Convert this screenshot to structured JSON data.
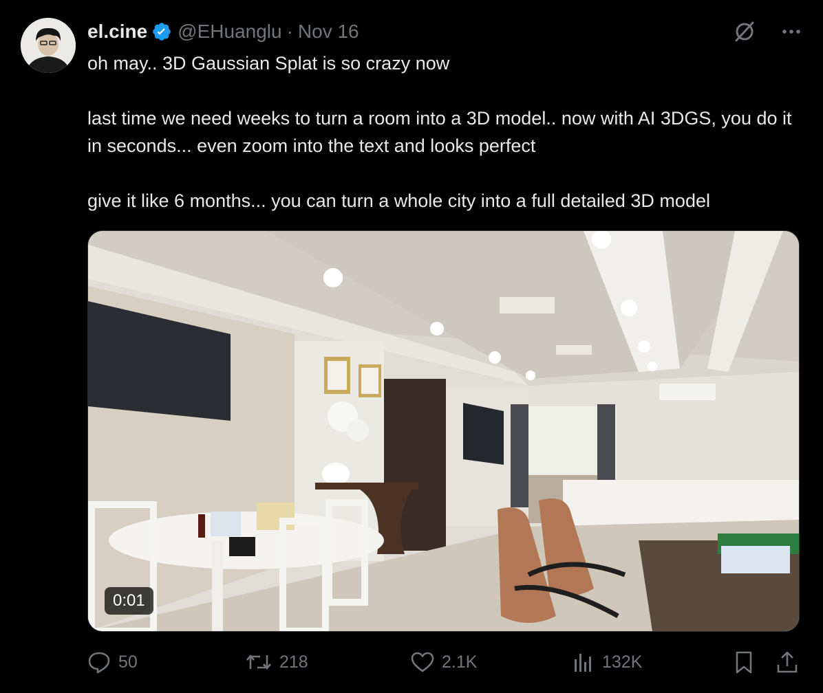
{
  "author": {
    "name": "el.cine",
    "handle": "@EHuanglu",
    "separator": "·",
    "date": "Nov 16",
    "verified": true
  },
  "tweet": {
    "paragraphs": [
      "oh may.. 3D Gaussian Splat is so crazy now",
      "last time we need weeks to turn a room into a 3D model.. now with AI 3DGS, you do it in seconds... even zoom into the text and looks perfect",
      "give it like 6 months... you can turn a whole city into a full detailed 3D model"
    ]
  },
  "media": {
    "type": "video",
    "timestamp": "0:01"
  },
  "actions": {
    "replies": "50",
    "reposts": "218",
    "likes": "2.1K",
    "views": "132K"
  },
  "icons": {
    "top": [
      "grok-icon",
      "more-icon"
    ],
    "actions": [
      "reply-icon",
      "repost-icon",
      "like-icon",
      "views-icon",
      "bookmark-icon",
      "share-icon"
    ]
  },
  "colors": {
    "background": "#000000",
    "text": "#e7e9ea",
    "secondary": "#71767b",
    "verified": "#1d9bf0"
  }
}
